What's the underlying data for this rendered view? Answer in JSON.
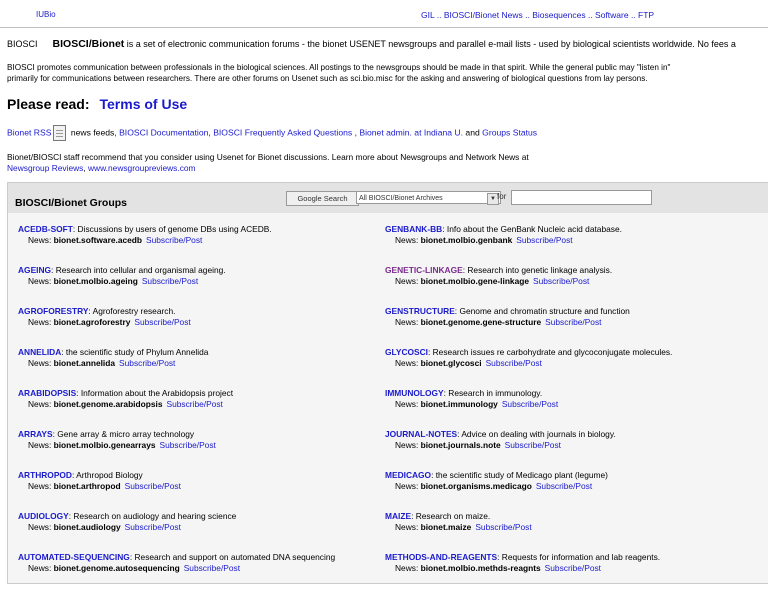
{
  "topbar": {
    "brand": "IUBio",
    "nav": [
      "GIL",
      "BIOSCI/Bionet News",
      "Biosequences",
      "Software",
      "FTP"
    ],
    "nav_sep": " .. "
  },
  "intro": {
    "label": "BIOSCI",
    "name": "BIOSCI/Bionet",
    "text1": " is a set of electronic communication forums - the bionet USENET newsgroups and parallel e-mail lists - used by biological scientists worldwide. No fees a",
    "text2a": "BIOSCI promotes communication between professionals in the biological sciences. All postings to the newsgroups should be made in that spirit. While the general public may \"listen in\"",
    "text2b": "primarily for communications between researchers. There are other forums on Usenet such as sci.bio.misc for the asking and answering of biological questions from lay persons."
  },
  "please": {
    "label": "Please read:",
    "link": "Terms of Use"
  },
  "links": {
    "rss": "Bionet RSS",
    "rss_after": " news feeds, ",
    "docs": "BIOSCI Documentation",
    "faq": "BIOSCI Frequently Asked Questions",
    "admin": "Bionet admin. at Indiana U.",
    "and": " and ",
    "status": "Groups Status"
  },
  "recommend": {
    "text": "Bionet/BIOSCI staff recommend that you consider using Usenet for Bionet discussions. Learn more about Newsgroups and Network News at",
    "link1": "Newsgroup Reviews",
    "link2": "www.newsgroupreviews.com"
  },
  "groups": {
    "title": "BIOSCI/Bionet Groups",
    "search_button": "Google Search",
    "search_scope": "All BIOSCI/Bionet Archives",
    "for_label": "for",
    "news_label": "News:",
    "subscribe": "Subscribe/Post",
    "left": [
      {
        "name": "ACEDB-SOFT",
        "desc": ": Discussions by users of genome DBs using ACEDB.",
        "news": "bionet.software.acedb"
      },
      {
        "name": "AGEING",
        "desc": ": Research into cellular and organismal ageing.",
        "news": "bionet.molbio.ageing"
      },
      {
        "name": "AGROFORESTRY",
        "desc": ": Agroforestry research.",
        "news": "bionet.agroforestry"
      },
      {
        "name": "ANNELIDA",
        "desc": ": the scientific study of Phylum Annelida",
        "news": "bionet.annelida"
      },
      {
        "name": "ARABIDOPSIS",
        "desc": ": Information about the Arabidopsis project",
        "news": "bionet.genome.arabidopsis"
      },
      {
        "name": "ARRAYS",
        "desc": ": Gene array & micro array technology",
        "news": "bionet.molbio.genearrays"
      },
      {
        "name": "ARTHROPOD",
        "desc": ": Arthropod Biology",
        "news": "bionet.arthropod"
      },
      {
        "name": "AUDIOLOGY",
        "desc": ": Research on audiology and hearing science",
        "news": "bionet.audiology"
      },
      {
        "name": "AUTOMATED-SEQUENCING",
        "desc": ": Research and support on automated DNA sequencing",
        "news": "bionet.genome.autosequencing"
      }
    ],
    "right": [
      {
        "name": "GENBANK-BB",
        "desc": ": Info about the GenBank Nucleic acid database.",
        "news": "bionet.molbio.genbank"
      },
      {
        "name": "GENETIC-LINKAGE",
        "desc": ": Research into genetic linkage analysis.",
        "news": "bionet.molbio.gene-linkage",
        "visited": true
      },
      {
        "name": "GENSTRUCTURE",
        "desc": ": Genome and chromatin structure and function",
        "news": "bionet.genome.gene-structure"
      },
      {
        "name": "GLYCOSCI",
        "desc": ": Research issues re carbohydrate and glycoconjugate molecules.",
        "news": "bionet.glycosci"
      },
      {
        "name": "IMMUNOLOGY",
        "desc": ": Research in immunology.",
        "news": "bionet.immunology"
      },
      {
        "name": "JOURNAL-NOTES",
        "desc": ": Advice on dealing with journals in biology.",
        "news": "bionet.journals.note"
      },
      {
        "name": "MEDICAGO",
        "desc": ": the scientific study of Medicago plant (legume)",
        "news": "bionet.organisms.medicago"
      },
      {
        "name": "MAIZE",
        "desc": ": Research on maize.",
        "news": "bionet.maize"
      },
      {
        "name": "METHODS-AND-REAGENTS",
        "desc": ": Requests for information and lab reagents.",
        "news": "bionet.molbio.methds-reagnts"
      }
    ]
  }
}
